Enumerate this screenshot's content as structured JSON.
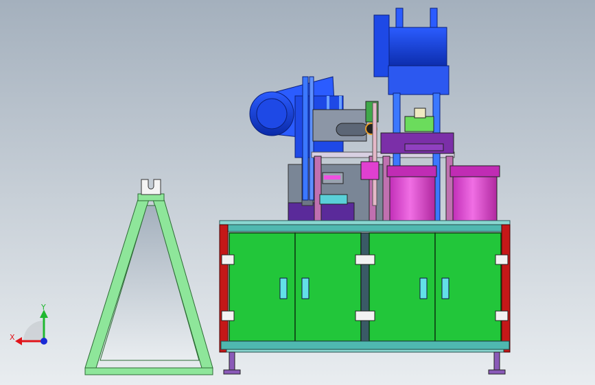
{
  "viewport": {
    "background_top": "#a4b0bd",
    "background_bottom": "#e9edf0"
  },
  "triad": {
    "x_label": "X",
    "y_label": "Y",
    "x_color": "#e1141a",
    "y_color": "#20b830",
    "z_color": "#1a2bd6"
  },
  "colors": {
    "cabinet_frame": "#c41818",
    "door_green": "#22c63a",
    "rail_teal": "#4fb8b0",
    "deck_cyan": "#8ad6d0",
    "motor_blue": "#0a3bd8",
    "feeder_magenta": "#e040d0",
    "bracket_purple": "#7b2fa8",
    "stand_green": "#8ee69a",
    "handle_cyan": "#62e0e8",
    "frame_pink": "#c070b0",
    "gray_plate": "#7a8696"
  }
}
